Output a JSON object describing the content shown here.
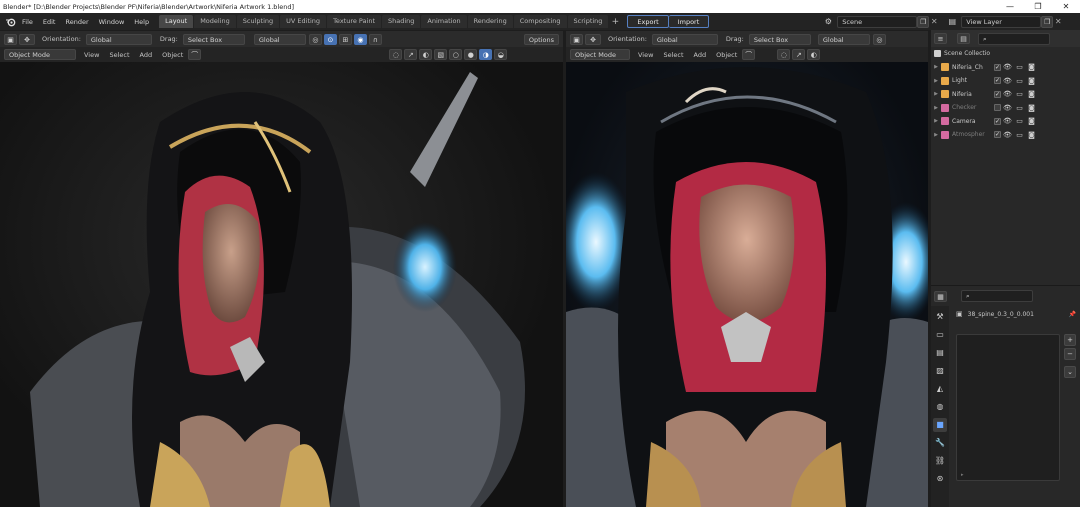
{
  "window": {
    "title": "Blender* [D:\\Blender Projects\\Blender PF\\Niferia\\Blender\\Artwork\\Niferia Artwork 1.blend]",
    "minimize": "—",
    "maximize": "❐",
    "close": "✕"
  },
  "menu": [
    "File",
    "Edit",
    "Render",
    "Window",
    "Help"
  ],
  "workspaces": [
    "Layout",
    "Modeling",
    "Sculpting",
    "UV Editing",
    "Texture Paint",
    "Shading",
    "Animation",
    "Rendering",
    "Compositing",
    "Scripting"
  ],
  "active_workspace": "Layout",
  "workspace_add": "+",
  "export_label": "Export",
  "import_label": "Import",
  "scene_field": "Scene",
  "view_layer_field": "View Layer",
  "viewport_left": {
    "orientation_label": "Orientation:",
    "orientation_value": "Global",
    "drag_label": "Drag:",
    "drag_value": "Select Box",
    "transform_value": "Global",
    "options_label": "Options",
    "mode": "Object Mode",
    "menus": [
      "View",
      "Select",
      "Add",
      "Object"
    ]
  },
  "viewport_right": {
    "orientation_label": "Orientation:",
    "orientation_value": "Global",
    "drag_label": "Drag:",
    "drag_value": "Select Box",
    "transform_value": "Global",
    "mode": "Object Mode",
    "menus": [
      "View",
      "Select",
      "Add",
      "Object"
    ]
  },
  "outliner": {
    "root": "Scene Collectio",
    "items": [
      {
        "name": "Niferia_Ch",
        "color": "#e8a94a",
        "checked": true,
        "dim": false
      },
      {
        "name": "Light",
        "color": "#e8a94a",
        "checked": true,
        "dim": false
      },
      {
        "name": "Niferia",
        "color": "#e8a94a",
        "checked": true,
        "dim": false
      },
      {
        "name": "Checker",
        "color": "#d46aa0",
        "checked": false,
        "dim": true
      },
      {
        "name": "Camera",
        "color": "#d46aa0",
        "checked": true,
        "dim": false
      },
      {
        "name": "Atmospher",
        "color": "#d46aa0",
        "checked": true,
        "dim": true
      }
    ]
  },
  "properties": {
    "object_name": "38_spine_0.3_0_0.001",
    "add": "+",
    "remove": "−",
    "dropdown": "⌄"
  },
  "colors": {
    "accent_blue": "#4772b3",
    "active_tab": "#474747"
  }
}
